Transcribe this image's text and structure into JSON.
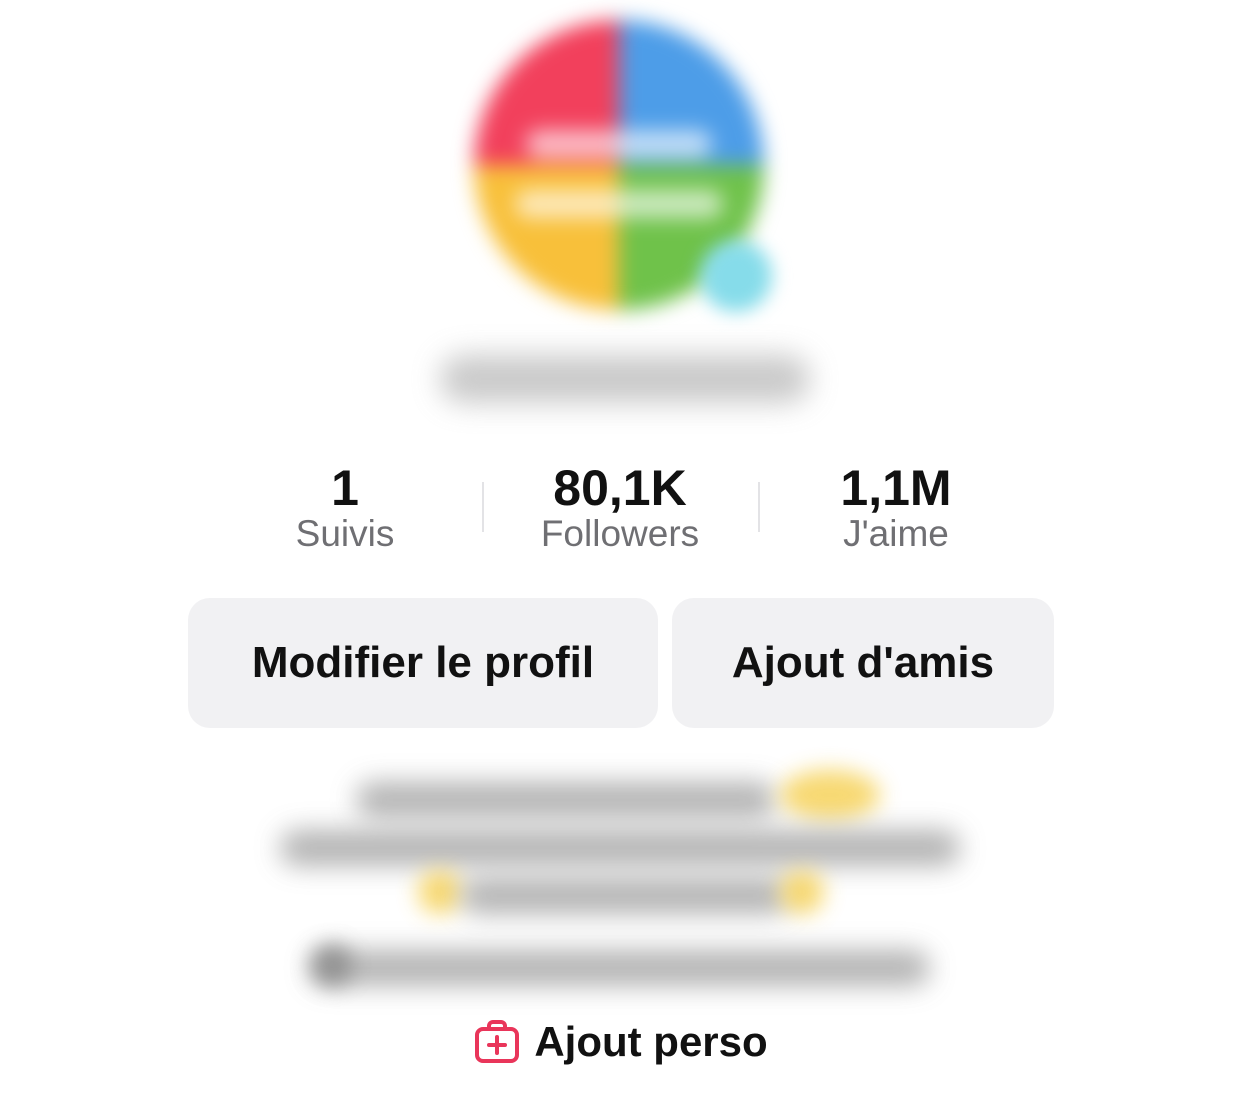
{
  "profile": {
    "stats": [
      {
        "value": "1",
        "label": "Suivis"
      },
      {
        "value": "80,1K",
        "label": "Followers"
      },
      {
        "value": "1,1M",
        "label": "J'aime"
      }
    ],
    "buttons": {
      "edit_profile": "Modifier le profil",
      "add_friends": "Ajout d'amis"
    },
    "add_personal": {
      "label": "Ajout perso",
      "icon": "add-bag-icon",
      "icon_color": "#e9355a"
    }
  },
  "colors": {
    "stat_label": "#6f6f73",
    "button_bg": "#f1f1f3",
    "accent": "#e9355a"
  }
}
